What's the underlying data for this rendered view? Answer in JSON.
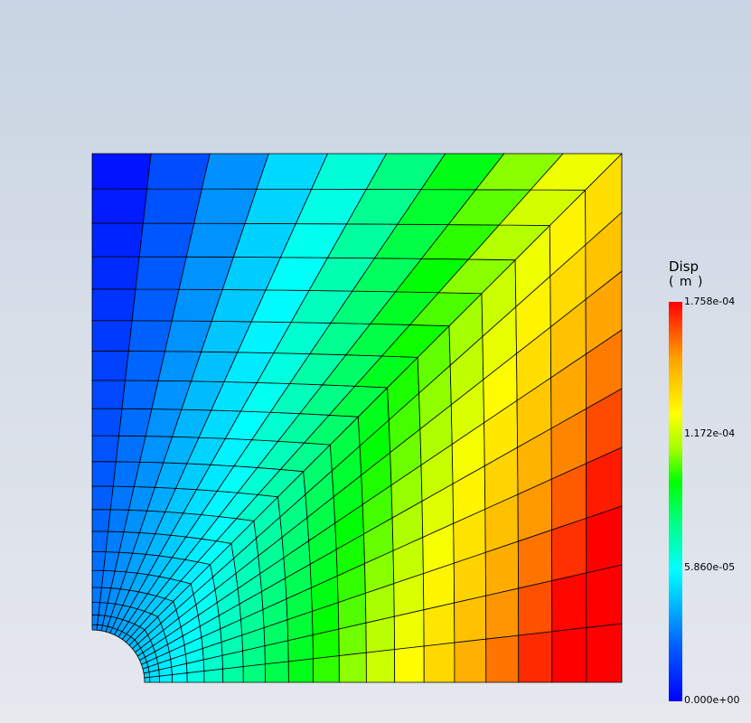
{
  "legend": {
    "title": "Disp",
    "unit": "( m )",
    "max_label": "1.758e-04",
    "mid_upper_label": "1.172e-04",
    "mid_lower_label": "5.860e-05",
    "min_label": "0.000e+00",
    "colors": [
      "#0000ff",
      "#00ffff",
      "#00ff00",
      "#ffff00",
      "#ff0000"
    ]
  },
  "model": {
    "field_name": "displacement",
    "field_min": 0.0,
    "field_max": 0.0001758,
    "mesh_radial_divisions": 20,
    "mesh_arc_divisions": 18,
    "geometry": "quarter plate with hole"
  }
}
